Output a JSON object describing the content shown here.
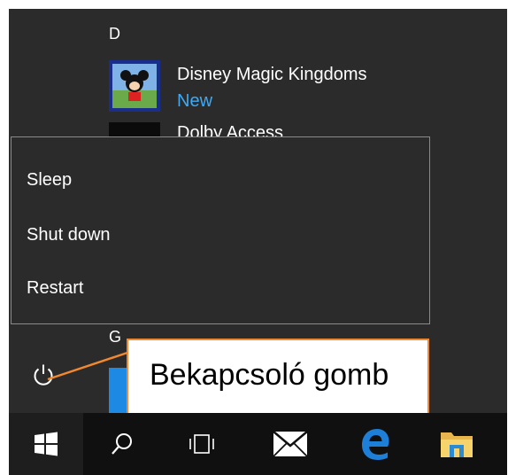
{
  "start_menu": {
    "section_letters": [
      "D",
      "G"
    ],
    "apps": [
      {
        "name": "Disney Magic Kingdoms",
        "badge": "New",
        "icon": "disney-magic-kingdoms-icon"
      },
      {
        "name": "Dolby Access",
        "icon": "dolby-access-icon"
      }
    ]
  },
  "power_menu": {
    "items": [
      "Sleep",
      "Shut down",
      "Restart"
    ]
  },
  "power_button": {
    "icon": "power-icon"
  },
  "callout": {
    "text": "Bekapcsoló gomb",
    "border_color": "#f0892f"
  },
  "taskbar": {
    "icons": [
      "windows-start-icon",
      "search-icon",
      "task-view-icon",
      "mail-icon",
      "edge-icon",
      "file-explorer-icon"
    ]
  },
  "colors": {
    "panel_bg": "#2b2b2b",
    "taskbar_bg": "#101010",
    "accent_blue": "#3fa9f5",
    "callout_orange": "#f0892f"
  }
}
